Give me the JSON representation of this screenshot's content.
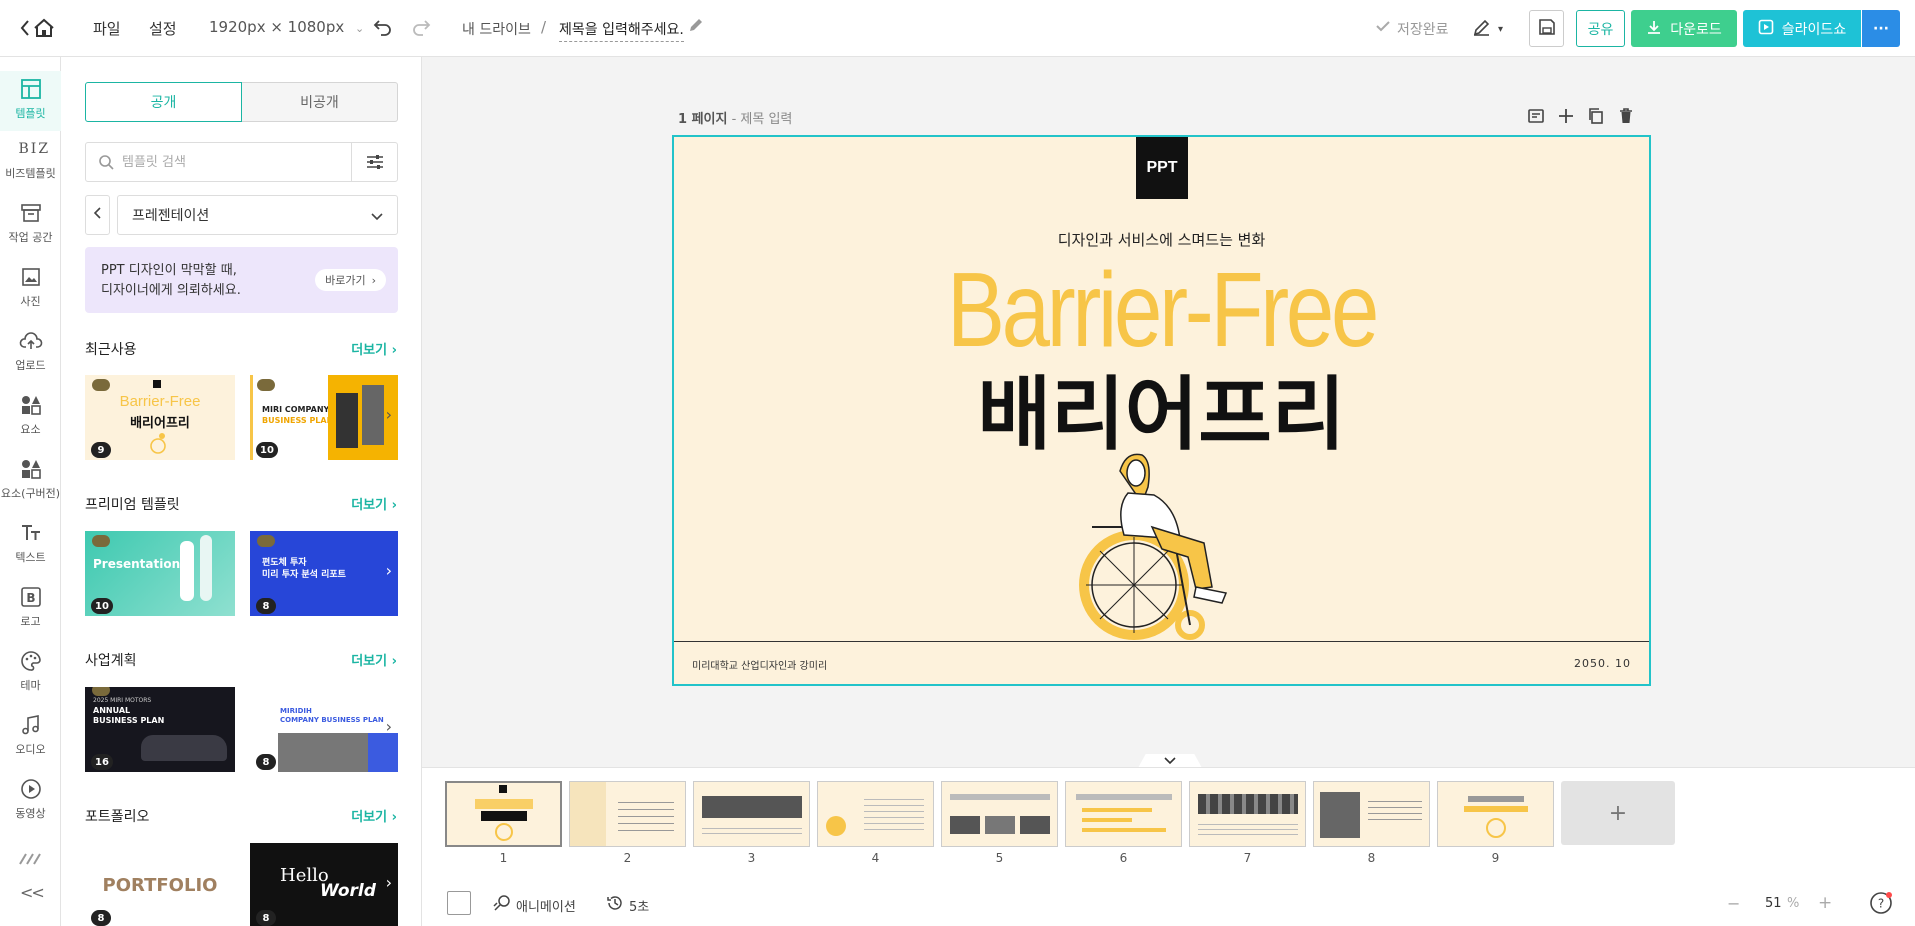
{
  "topbar": {
    "menu_file": "파일",
    "menu_settings": "설정",
    "canvas_size": "1920px × 1080px",
    "breadcrumb_root": "내 드라이브",
    "breadcrumb_sep": "/",
    "doc_title": "제목을 입력해주세요.",
    "save_status": "저장완료",
    "share_label": "공유",
    "download_label": "다운로드",
    "slideshow_label": "슬라이드쇼",
    "more_label": "···"
  },
  "rail": {
    "items": [
      {
        "label": "템플릿",
        "icon": "template-icon"
      },
      {
        "label": "비즈템플릿",
        "icon": "biz-icon",
        "mark": "BIZ"
      },
      {
        "label": "작업 공간",
        "icon": "workspace-icon"
      },
      {
        "label": "사진",
        "icon": "photo-icon"
      },
      {
        "label": "업로드",
        "icon": "upload-icon"
      },
      {
        "label": "요소",
        "icon": "elements-icon"
      },
      {
        "label": "요소(구버전)",
        "icon": "elements-legacy-icon"
      },
      {
        "label": "텍스트",
        "icon": "text-icon"
      },
      {
        "label": "로고",
        "icon": "logo-icon"
      },
      {
        "label": "테마",
        "icon": "theme-icon"
      },
      {
        "label": "오디오",
        "icon": "audio-icon"
      },
      {
        "label": "동영상",
        "icon": "video-icon"
      }
    ],
    "collapse_label": "<<"
  },
  "panel": {
    "tab_public": "공개",
    "tab_private": "비공개",
    "search_placeholder": "템플릿 검색",
    "category": "프레젠테이션",
    "banner_line1": "PPT 디자인이 막막할 때,",
    "banner_line2": "디자이너에게 의뢰하세요.",
    "banner_button": "바로가기",
    "more_label": "더보기",
    "sections": [
      {
        "title": "최근사용",
        "counts": [
          "9",
          "10"
        ]
      },
      {
        "title": "프리미엄 템플릿",
        "counts": [
          "10",
          "8"
        ]
      },
      {
        "title": "사업계획",
        "counts": [
          "16",
          "8"
        ]
      },
      {
        "title": "포트폴리오",
        "counts": [
          "8",
          "8"
        ]
      }
    ],
    "thumb_texts": {
      "recent1_a": "Barrier-Free",
      "recent1_b": "배리어프리",
      "recent2_a": "MIRI COMPANY",
      "recent2_b": "BUSINESS PLAN",
      "premium1": "Presentation",
      "premium2_a": "편도체 투자",
      "premium2_b": "미리 투자 분석 리포트",
      "biz1_a": "2025 MIRI MOTORS",
      "biz1_b": "ANNUAL",
      "biz1_c": "BUSINESS PLAN",
      "biz2_a": "MIRIDIH",
      "biz2_b": "COMPANY BUSINESS PLAN",
      "port1": "PORTFOLIO",
      "port2_a": "Hello",
      "port2_b": "World"
    }
  },
  "canvas": {
    "page_label_bold": "1 페이지",
    "page_label_rest": " - 제목 입력"
  },
  "slide": {
    "logo": "PPT",
    "subtitle": "디자인과 서비스에 스며드는 변화",
    "title_en": "Barrier-Free",
    "title_ko": "배리어프리",
    "footer_left": "미리대학교 산업디자인과  강미리",
    "footer_right": "2050. 10"
  },
  "filmstrip": {
    "pages": [
      "1",
      "2",
      "3",
      "4",
      "5",
      "6",
      "7",
      "8",
      "9"
    ],
    "add_label": "+",
    "animation_label": "애니메이션",
    "duration_label": "5초",
    "zoom_value": "51",
    "zoom_unit": "%"
  },
  "colors": {
    "accent": "#1bb5a3",
    "download": "#3ecf8e",
    "slideshow": "#1ec2d6",
    "slide_bg": "#fdf2dc",
    "slide_yellow": "#f7c548",
    "selection": "#22c3c9"
  }
}
